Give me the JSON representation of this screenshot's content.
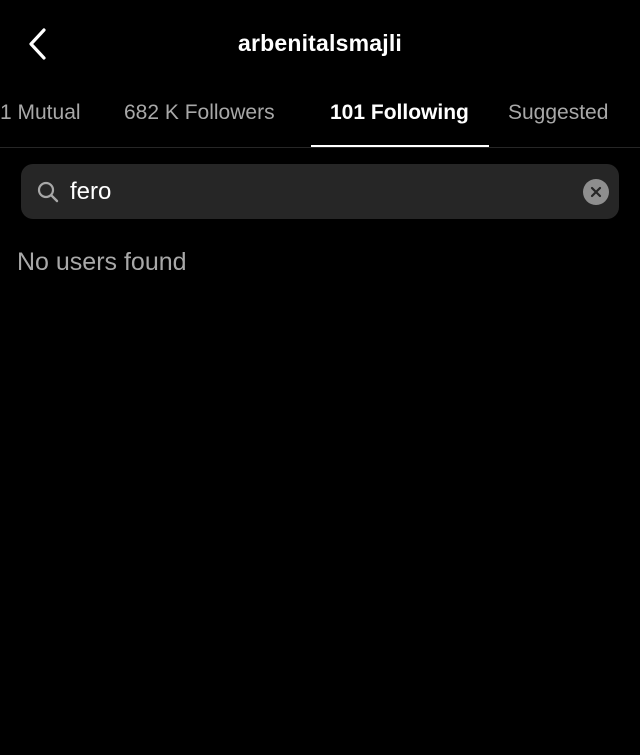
{
  "header": {
    "title": "arbenitalsmajli",
    "back_icon": "chevron-left-icon"
  },
  "tabs": [
    {
      "label": "1 Mutual",
      "active": false
    },
    {
      "label": "682 K Followers",
      "active": false
    },
    {
      "label": "101 Following",
      "active": true
    },
    {
      "label": "Suggested",
      "active": false
    }
  ],
  "search": {
    "value": "fero",
    "icon": "search-icon",
    "clear_icon": "clear-icon"
  },
  "results": {
    "empty_message": "No users found"
  },
  "colors": {
    "background": "#000000",
    "search_bg": "#262626",
    "inactive_text": "#a8a8a8",
    "active_text": "#ffffff"
  }
}
